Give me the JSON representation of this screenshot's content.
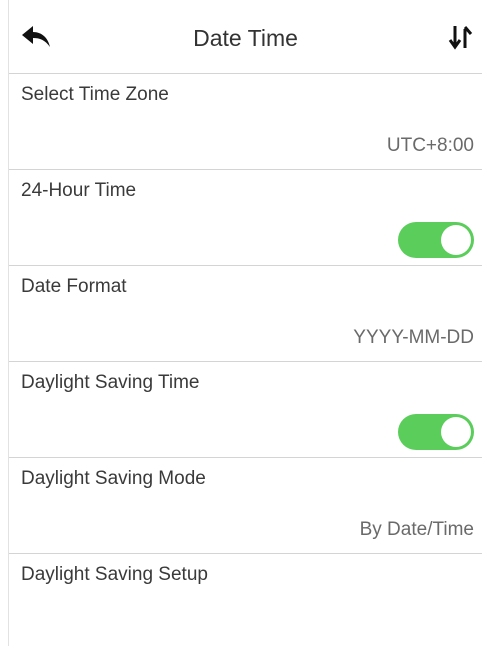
{
  "header": {
    "title": "Date Time",
    "back_icon": "back-arrow-icon",
    "sort_icon": "sort-arrows-icon"
  },
  "colors": {
    "toggle_on": "#5acd5b",
    "divider": "#d4d4d4",
    "text": "#333333"
  },
  "settings": [
    {
      "label": "Select Time Zone",
      "value": "UTC+8:00"
    },
    {
      "label": "24-Hour Time",
      "toggle": true
    },
    {
      "label": "Date Format",
      "value": "YYYY-MM-DD"
    },
    {
      "label": "Daylight Saving Time",
      "toggle": true
    },
    {
      "label": "Daylight Saving Mode",
      "value": "By Date/Time"
    },
    {
      "label": "Daylight Saving Setup"
    }
  ]
}
